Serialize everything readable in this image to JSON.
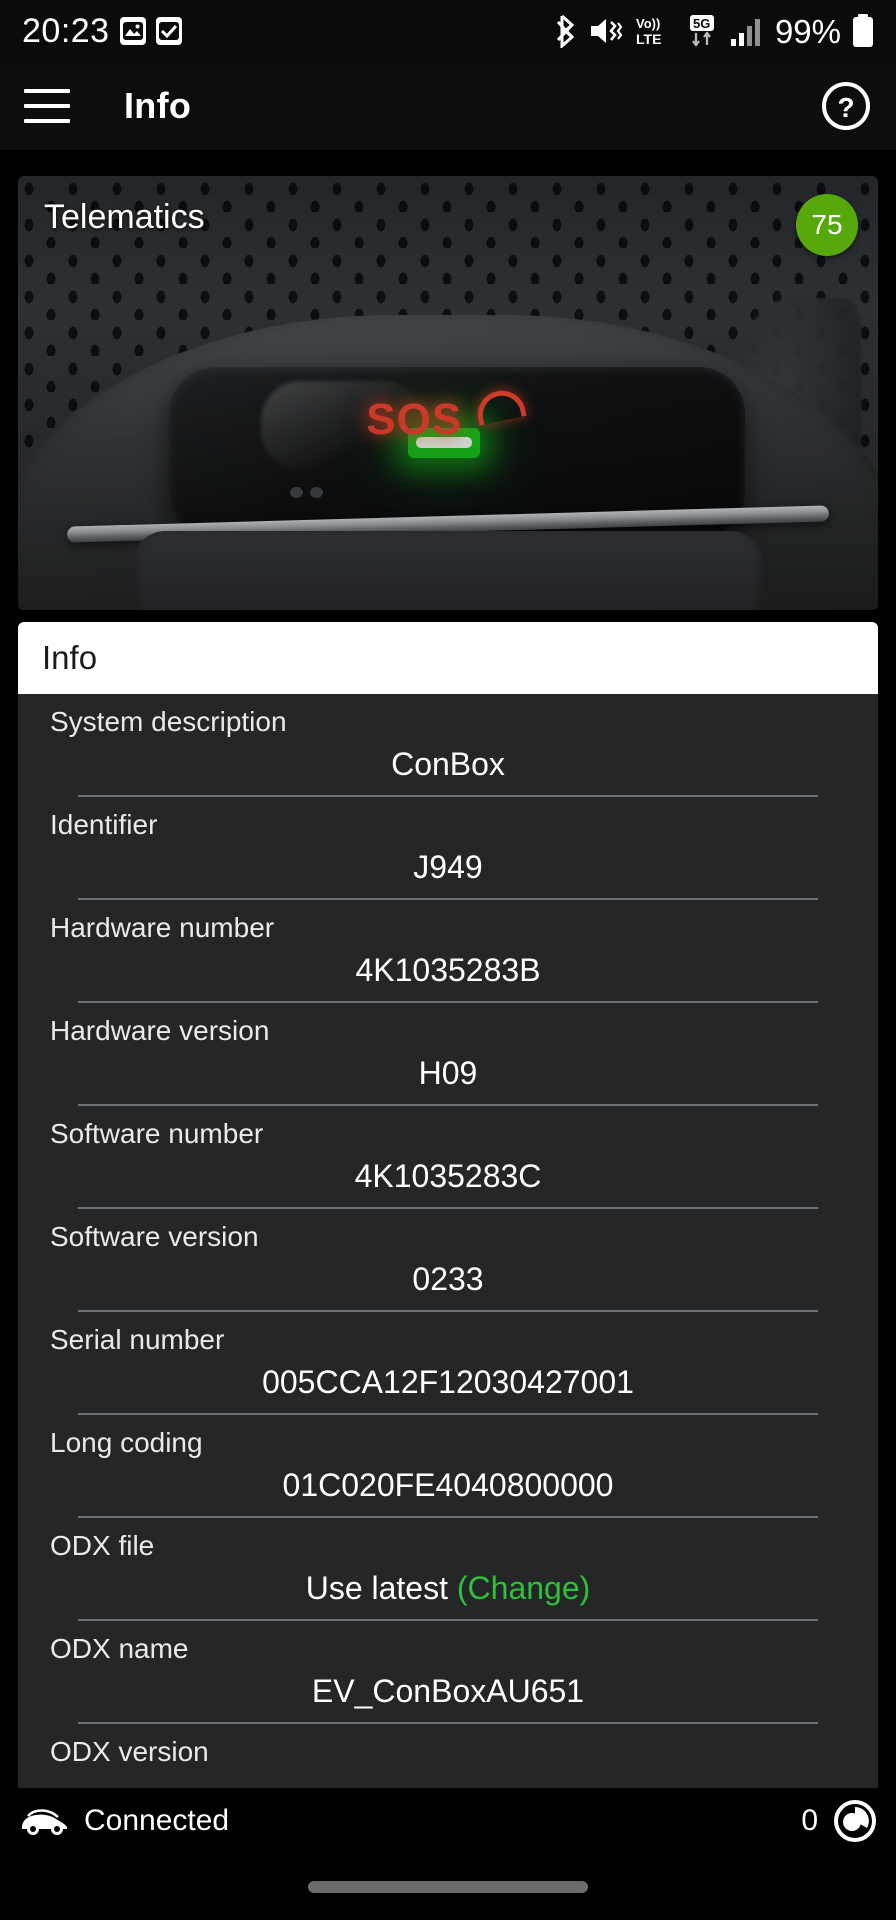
{
  "status_bar": {
    "clock": "20:23",
    "battery_percent": "99%",
    "icons": [
      "photo-icon",
      "checkbox-checked-icon",
      "bluetooth-icon",
      "vibrate-mute-icon",
      "volte-icon",
      "5g-data-icon",
      "signal-bars-icon",
      "battery-icon"
    ],
    "volte_label_top": "Vo))",
    "volte_label_bottom": "LTE",
    "network_label": "5G"
  },
  "app_bar": {
    "menu_icon": "hamburger-menu-icon",
    "title": "Info",
    "help_icon": "help-circle-icon"
  },
  "hero": {
    "title": "Telematics",
    "badge_value": "75",
    "badge_color": "#57a80d",
    "sos_label": "SOS",
    "led_color": "#18c21c",
    "sos_color": "#e8422e"
  },
  "card": {
    "header_title": "Info",
    "accent_link_color": "#2fbf3a",
    "rows": [
      {
        "label": "System description",
        "value": "ConBox"
      },
      {
        "label": "Identifier",
        "value": "J949"
      },
      {
        "label": "Hardware number",
        "value": "4K1035283B"
      },
      {
        "label": "Hardware version",
        "value": "H09"
      },
      {
        "label": "Software number",
        "value": "4K1035283C"
      },
      {
        "label": "Software version",
        "value": "0233"
      },
      {
        "label": "Serial number",
        "value": "005CCA12F12030427001"
      },
      {
        "label": "Long coding",
        "value": "01C020FE4040800000"
      },
      {
        "label": "ODX file",
        "value": "Use latest",
        "link": "(Change)"
      },
      {
        "label": "ODX name",
        "value": "EV_ConBoxAU651"
      },
      {
        "label": "ODX version",
        "value": ""
      }
    ]
  },
  "bottom_bar": {
    "car_icon": "car-icon",
    "status_text": "Connected",
    "count": "0",
    "fault_icon": "fault-counter-icon"
  }
}
